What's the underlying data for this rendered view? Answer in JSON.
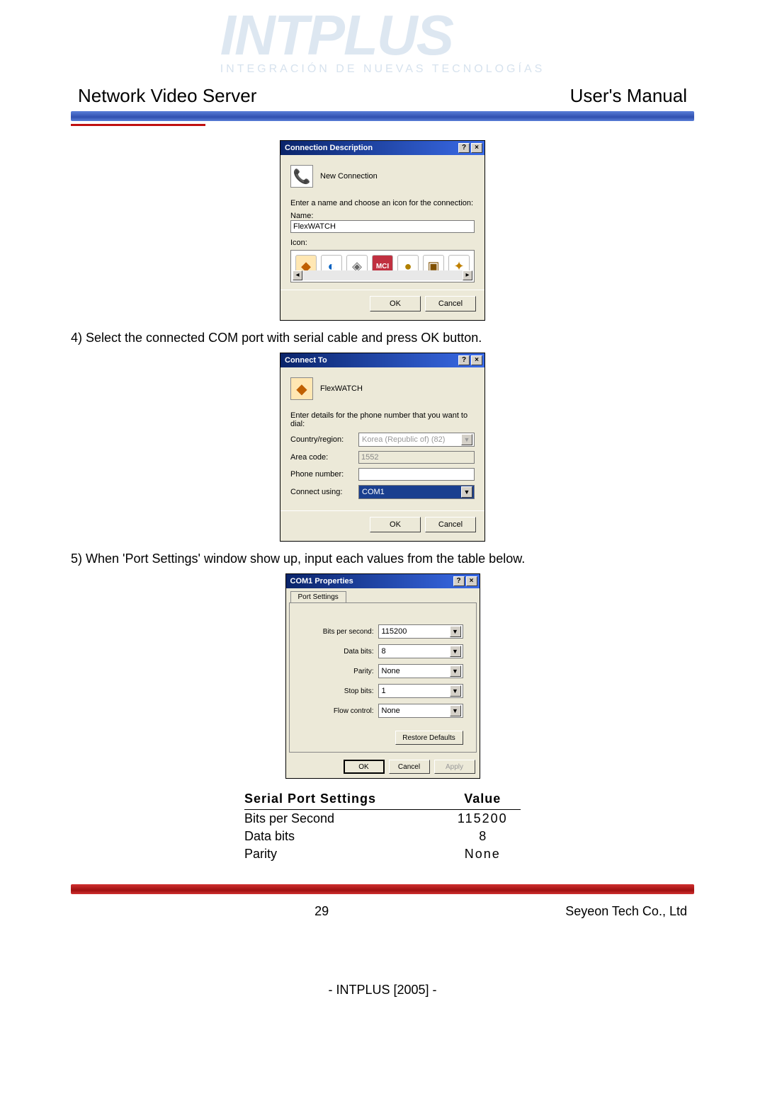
{
  "watermark": {
    "brand": "INTPLUS",
    "tagline": "INTEGRACIÓN DE NUEVAS TECNOLOGÍAS"
  },
  "header": {
    "left": "Network Video Server",
    "right": "User's Manual"
  },
  "dialog1": {
    "title": "Connection Description",
    "new_connection_label": "New Connection",
    "prompt": "Enter a name and choose an icon for the connection:",
    "name_label": "Name:",
    "name_value": "FlexWATCH",
    "icon_label": "Icon:",
    "ok": "OK",
    "cancel": "Cancel"
  },
  "step4": "4)  Select the connected COM port with serial cable and press OK button.",
  "dialog2": {
    "title": "Connect To",
    "fw_label": "FlexWATCH",
    "prompt": "Enter details for the phone number that you want to dial:",
    "country_label": "Country/region:",
    "country_value": "Korea (Republic of) (82)",
    "area_label": "Area code:",
    "area_value": "1552",
    "phone_label": "Phone number:",
    "phone_value": "",
    "connect_label": "Connect using:",
    "connect_value": "COM1",
    "ok": "OK",
    "cancel": "Cancel"
  },
  "step5": "5)  When 'Port Settings' window show up, input each values from the table below.",
  "dialog3": {
    "title": "COM1 Properties",
    "tab": "Port Settings",
    "bps_label": "Bits per second:",
    "bps_value": "115200",
    "data_label": "Data bits:",
    "data_value": "8",
    "parity_label": "Parity:",
    "parity_value": "None",
    "stop_label": "Stop bits:",
    "stop_value": "1",
    "flow_label": "Flow control:",
    "flow_value": "None",
    "restore": "Restore Defaults",
    "ok": "OK",
    "cancel": "Cancel",
    "apply": "Apply"
  },
  "settings_table": {
    "h1": "Serial Port Settings",
    "h2": "Value",
    "rows": [
      {
        "k": "Bits per Second",
        "v": "115200"
      },
      {
        "k": "Data bits",
        "v": "8"
      },
      {
        "k": "Parity",
        "v": "None"
      }
    ]
  },
  "footer": {
    "page": "29",
    "company": "Seyeon Tech Co., Ltd",
    "brandline": "- INTPLUS [2005] -"
  }
}
